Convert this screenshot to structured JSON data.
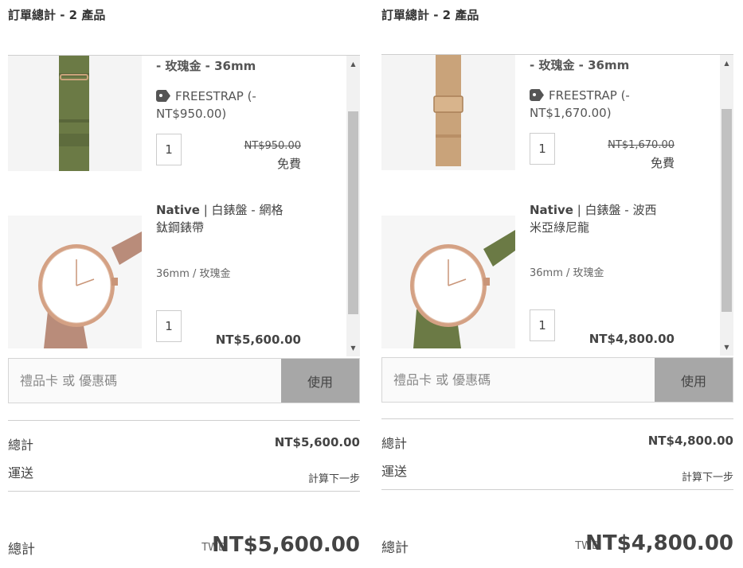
{
  "panels": [
    {
      "order_title": "訂單總計 - 2 產品",
      "item1": {
        "name_tail": "- 玫瑰金 - 36mm",
        "promo": "FREESTRAP (-NT$950.00)",
        "qty": "1",
        "old_price": "NT$950.00",
        "price": "免費"
      },
      "item2": {
        "name_bold": "Native",
        "name_rest": " | 白錶盤 - 網格鈦鋼錶帶",
        "variant": "36mm / 玫瑰金",
        "qty": "1",
        "price": "NT$5,600.00"
      },
      "coupon_placeholder": "禮品卡 或 優惠碼",
      "apply_label": "使用",
      "subtotal_label": "總計",
      "subtotal_value": "NT$5,600.00",
      "shipping_label": "運送",
      "shipping_value": "計算下一步",
      "total_label": "總計",
      "currency": "TWD",
      "total_value": "NT$5,600.00"
    },
    {
      "order_title": "訂單總計 - 2 產品",
      "item1": {
        "name_tail": "- 玫瑰金 - 36mm",
        "promo": "FREESTRAP (-NT$1,670.00)",
        "qty": "1",
        "old_price": "NT$1,670.00",
        "price": "免費"
      },
      "item2": {
        "name_bold": "Native",
        "name_rest": " | 白錶盤 - 波西米亞綠尼龍",
        "variant": "36mm / 玫瑰金",
        "qty": "1",
        "price": "NT$4,800.00"
      },
      "coupon_placeholder": "禮品卡 或 優惠碼",
      "apply_label": "使用",
      "subtotal_label": "總計",
      "subtotal_value": "NT$4,800.00",
      "shipping_label": "運送",
      "shipping_value": "計算下一步",
      "total_label": "總計",
      "currency": "TWD",
      "total_value": "NT$4,800.00"
    }
  ],
  "colors": {
    "strap_green": "#6b7a45",
    "strap_mesh_gold": "#c9a37a",
    "rose_gold": "#c99578",
    "mesh_rose": "#b98c7a",
    "apply_button_bg": "#a7a7a7"
  },
  "icons": [
    "tag-icon",
    "scroll-up-arrow-icon",
    "scroll-down-arrow-icon"
  ]
}
